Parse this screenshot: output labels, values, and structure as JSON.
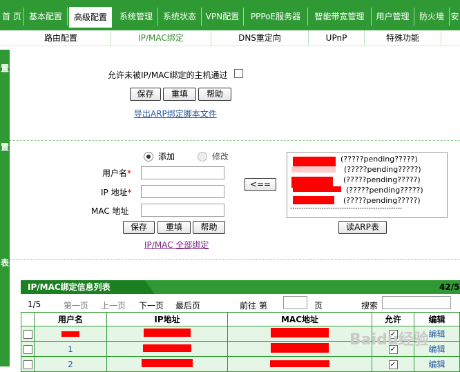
{
  "top_nav": {
    "tabs": [
      "首 页",
      "基本配置",
      "高级配置",
      "系统管理",
      "系统状态",
      "VPN配置",
      "PPPoE服务器",
      "智能带宽管理",
      "用户管理",
      "防火墙",
      "安"
    ]
  },
  "sub_nav": {
    "tabs": [
      "路由配置",
      "IP/MAC绑定",
      "DNS重定向",
      "UPnP",
      "特殊功能"
    ]
  },
  "side_labels": [
    "置",
    "置",
    "表"
  ],
  "global": {
    "allow_unbound_label": "允许未被IP/MAC绑定的主机通过",
    "save": "保存",
    "reset": "重填",
    "help": "帮助",
    "export_link": "导出ARP绑定脚本文件"
  },
  "bind_form": {
    "radio_add": "添加",
    "radio_modify": "修改",
    "username_label": "用户名",
    "ip_label": "IP 地址",
    "mac_label": "MAC 地址",
    "required_mark": "*",
    "save": "保存",
    "reset": "重填",
    "help": "帮助",
    "bind_all_link": "IP/MAC 全部绑定",
    "arrow_button": "<=="
  },
  "arp": {
    "entries": [
      "(?????pending?????)",
      "(?????pending?????)",
      "(?????pending?????)",
      "(?????pending?????)",
      "(?????pending?????)"
    ],
    "dashes": "--------------------------------------------------",
    "read_button": "读ARP表"
  },
  "list": {
    "title": "IP/MAC绑定信息列表",
    "count": "42/50",
    "page_indicator": "1/5",
    "first": "第一页",
    "prev": "上一页",
    "next": "下一页",
    "last": "最后页",
    "goto_label": "前往 第",
    "page_unit": "页",
    "search_label": "搜索",
    "columns": [
      "用户名",
      "IP地址",
      "MAC地址",
      "允许",
      "编辑"
    ],
    "rows": [
      {
        "name": "",
        "ip": "",
        "mac": "",
        "edit": "编辑"
      },
      {
        "name": "1",
        "ip": "",
        "mac": "",
        "edit": "编辑"
      },
      {
        "name": "2",
        "ip": "",
        "mac": "",
        "edit": "编辑"
      }
    ]
  },
  "watermark": "Baidu经验"
}
